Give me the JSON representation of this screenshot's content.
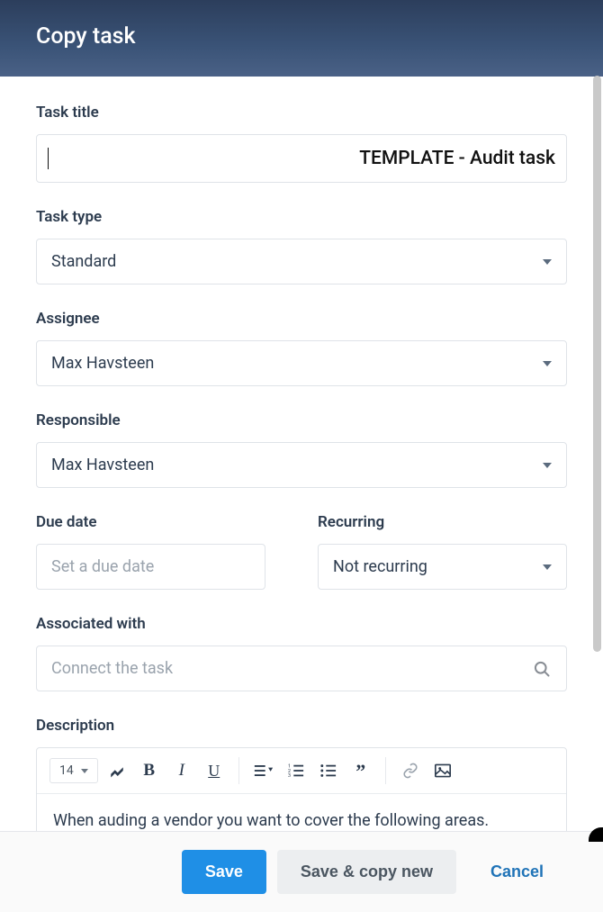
{
  "header": {
    "title": "Copy task"
  },
  "fields": {
    "task_title": {
      "label": "Task title",
      "value": "TEMPLATE - Audit task"
    },
    "task_type": {
      "label": "Task type",
      "value": "Standard"
    },
    "assignee": {
      "label": "Assignee",
      "value": "Max Havsteen"
    },
    "responsible": {
      "label": "Responsible",
      "value": "Max Havsteen"
    },
    "due_date": {
      "label": "Due date",
      "placeholder": "Set a due date"
    },
    "recurring": {
      "label": "Recurring",
      "value": "Not recurring"
    },
    "associated": {
      "label": "Associated with",
      "placeholder": "Connect the task"
    },
    "description": {
      "label": "Description",
      "font_size": "14",
      "body": "When auding a vendor you want to cover the following areas."
    }
  },
  "footer": {
    "save": "Save",
    "save_copy": "Save & copy new",
    "cancel": "Cancel"
  }
}
